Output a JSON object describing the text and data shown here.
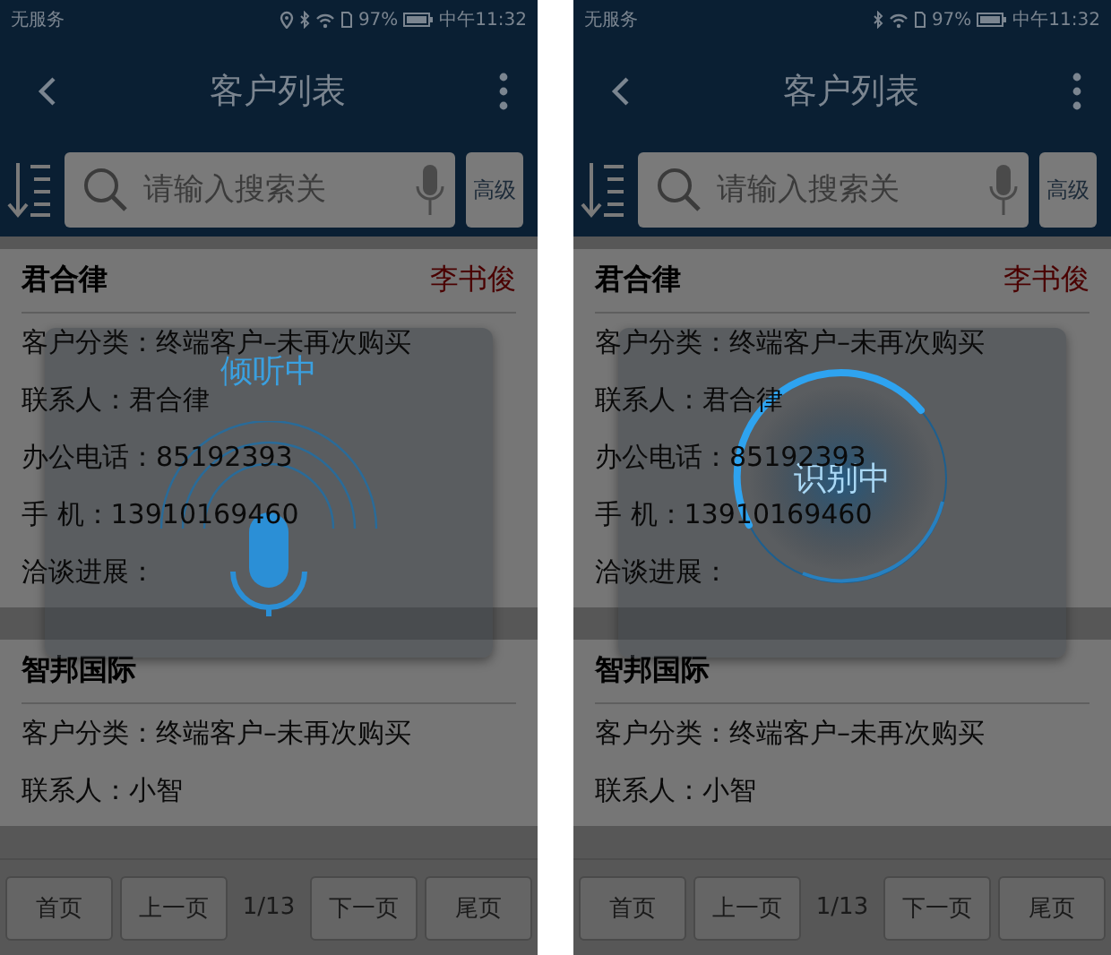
{
  "phones": [
    {
      "status_bar": {
        "carrier": "无服务",
        "location": true,
        "battery": "97%",
        "time": "中午11:32"
      },
      "title": "客户列表",
      "search": {
        "placeholder": "请输入搜索关"
      },
      "advanced_button": "高级",
      "customers": [
        {
          "name": "君合律",
          "owner": "李书俊",
          "fields": [
            "客户分类：终端客户–未再次购买",
            "联系人：君合律",
            "办公电话：85192393",
            "手 机：13910169460",
            "洽谈进展："
          ]
        },
        {
          "name": "智邦国际",
          "fields": [
            "客户分类：终端客户–未再次购买",
            "联系人：小智"
          ]
        }
      ],
      "pager": {
        "first": "首页",
        "prev": "上一页",
        "page": "1/13",
        "next": "下一页",
        "last": "尾页"
      },
      "voice_dialog": {
        "kind": "listening",
        "label": "倾听中"
      }
    },
    {
      "status_bar": {
        "carrier": "无服务",
        "location": false,
        "battery": "97%",
        "time": "中午11:32"
      },
      "title": "客户列表",
      "search": {
        "placeholder": "请输入搜索关"
      },
      "advanced_button": "高级",
      "customers": [
        {
          "name": "君合律",
          "owner": "李书俊",
          "fields": [
            "客户分类：终端客户–未再次购买",
            "联系人：君合律",
            "办公电话：85192393",
            "手 机：13910169460",
            "洽谈进展："
          ]
        },
        {
          "name": "智邦国际",
          "fields": [
            "客户分类：终端客户–未再次购买",
            "联系人：小智"
          ]
        }
      ],
      "pager": {
        "first": "首页",
        "prev": "上一页",
        "page": "1/13",
        "next": "下一页",
        "last": "尾页"
      },
      "voice_dialog": {
        "kind": "recognizing",
        "label": "识别中"
      }
    }
  ]
}
